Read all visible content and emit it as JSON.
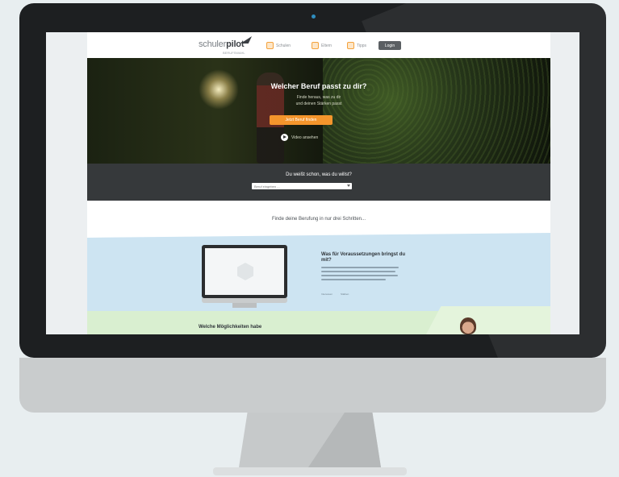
{
  "site": {
    "logo": {
      "prefix": "schuler",
      "bold": "pilot",
      "sub": "BERUFSWAHL"
    },
    "nav": [
      {
        "label": "Schulen"
      },
      {
        "label": "Eltern"
      },
      {
        "label": "Tipps"
      }
    ],
    "nav_button": "Login",
    "hero": {
      "title": "Welcher Beruf passt zu dir?",
      "subtitle_1": "Finde heraus, was zu dir",
      "subtitle_2": "und deinen Stärken passt",
      "cta": "Jetzt Beruf finden",
      "video": "Video ansehen"
    },
    "search": {
      "title": "Du weißt schon, was du willst?",
      "placeholder": "Beruf eingeben ..."
    },
    "steps_title": "Finde deine Berufung in nur drei Schritten...",
    "info": {
      "title": "Was für Voraussetzungen bringst du mit?",
      "link_1": "Interessen",
      "link_2": "Stärken"
    },
    "next_title": "Welche Möglichkeiten habe"
  },
  "colors": {
    "accent": "#f4952c",
    "dark_band": "#36393b",
    "blue_band": "#cde4f2",
    "green_band": "#d9efd0"
  }
}
